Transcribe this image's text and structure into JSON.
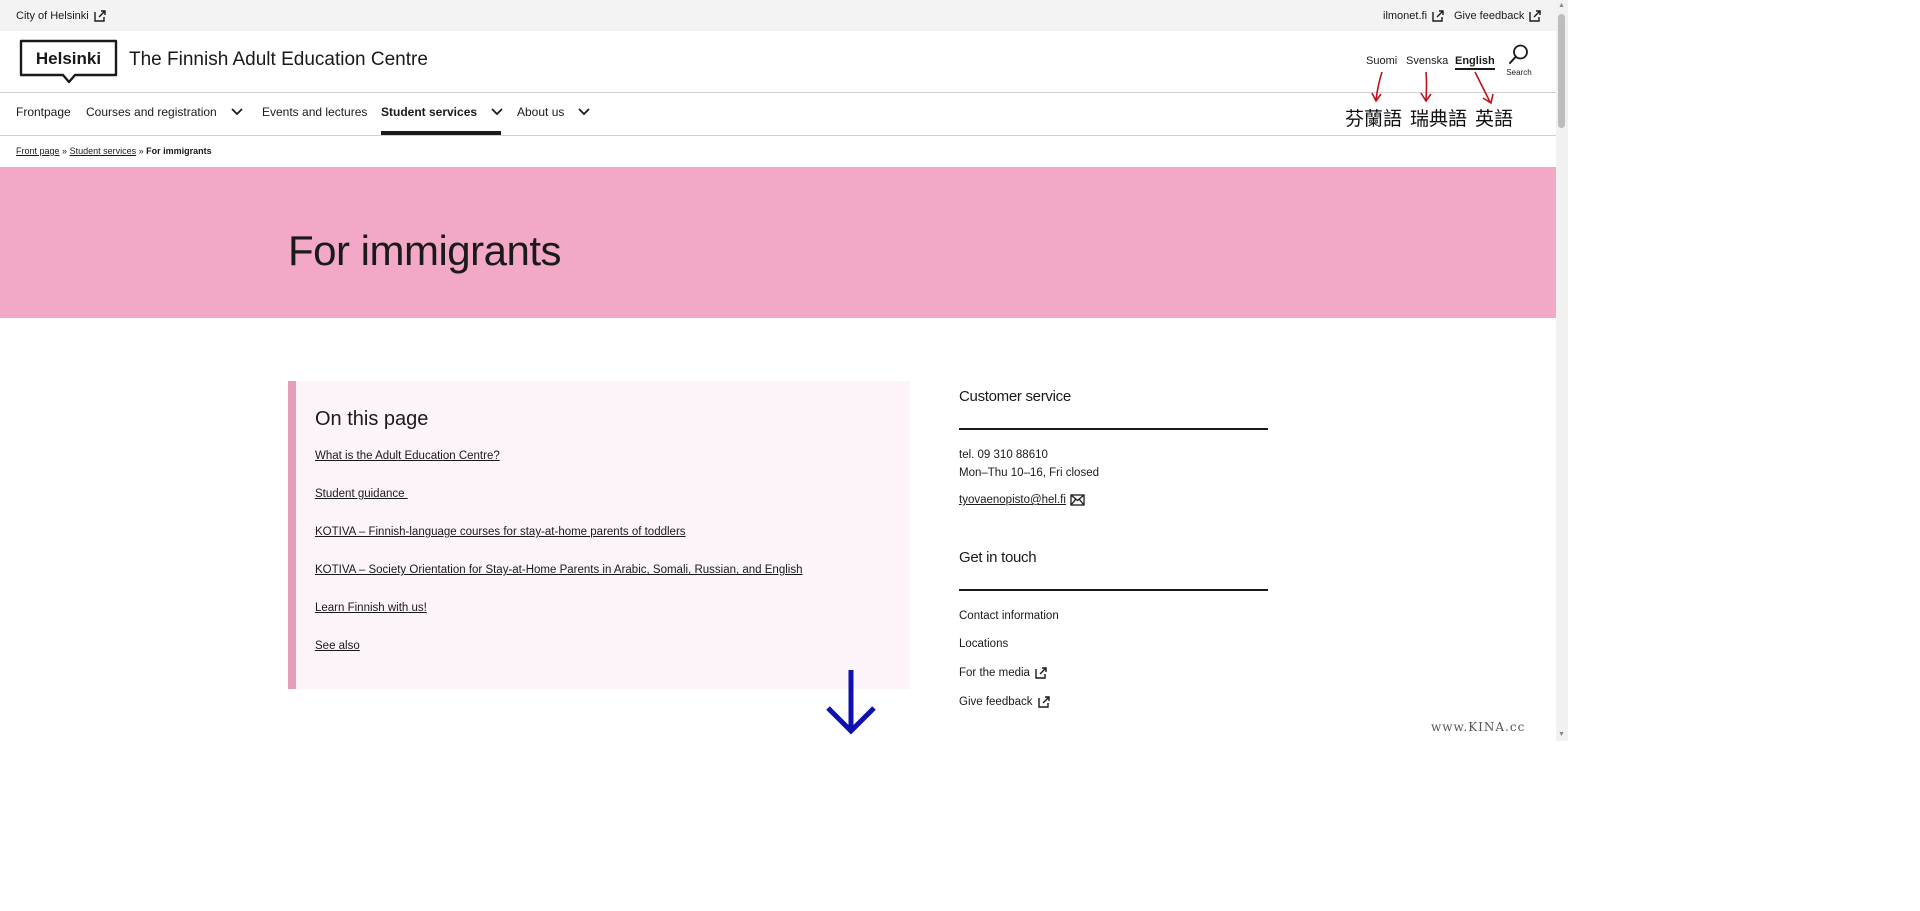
{
  "utility_bar": {
    "city_link": "City of Helsinki",
    "ilmonet_link": "ilmonet.fi",
    "feedback_link": "Give feedback"
  },
  "header": {
    "logo_text": "Helsinki",
    "site_title": "The Finnish Adult Education Centre",
    "languages": [
      {
        "label": "Suomi",
        "active": false
      },
      {
        "label": "Svenska",
        "active": false
      },
      {
        "label": "English",
        "active": true
      }
    ],
    "search_label": "Search"
  },
  "annotations": {
    "finnish": "芬蘭語",
    "swedish": "瑞典語",
    "english": "英語",
    "arrow_color": "#c0121c",
    "down_arrow_color": "#1010b0"
  },
  "nav": {
    "items": [
      {
        "label": "Frontpage",
        "has_dropdown": false,
        "active": false
      },
      {
        "label": "Courses and registration",
        "has_dropdown": true,
        "active": false
      },
      {
        "label": "Events and lectures",
        "has_dropdown": false,
        "active": false
      },
      {
        "label": "Student services",
        "has_dropdown": true,
        "active": true
      },
      {
        "label": "About us",
        "has_dropdown": true,
        "active": false
      }
    ]
  },
  "breadcrumb": {
    "items": [
      "Front page",
      "Student services"
    ],
    "separator": "»",
    "current": "For immigrants"
  },
  "hero": {
    "title": "For immigrants",
    "background": "#f2a8c6"
  },
  "toc": {
    "title": "On this page",
    "links": [
      "What is the Adult Education Centre?",
      "Student guidance ",
      "KOTIVA – Finnish-language courses for stay-at-home parents of toddlers",
      "KOTIVA – Society Orientation for Stay-at-Home Parents in Arabic, Somali, Russian, and English",
      "Learn Finnish with us!",
      "See also"
    ]
  },
  "sidebar": {
    "customer_service": {
      "title": "Customer service",
      "phone": "tel. 09 310 88610",
      "hours": "Mon–Thu 10–16, Fri closed",
      "email": "tyovaenopisto@hel.fi"
    },
    "get_in_touch": {
      "title": "Get in touch",
      "links": [
        {
          "label": "Contact information",
          "external": false
        },
        {
          "label": "Locations",
          "external": false
        },
        {
          "label": "For the media",
          "external": true
        },
        {
          "label": "Give feedback",
          "external": true
        }
      ]
    }
  },
  "watermark": "www.KINA.cc"
}
